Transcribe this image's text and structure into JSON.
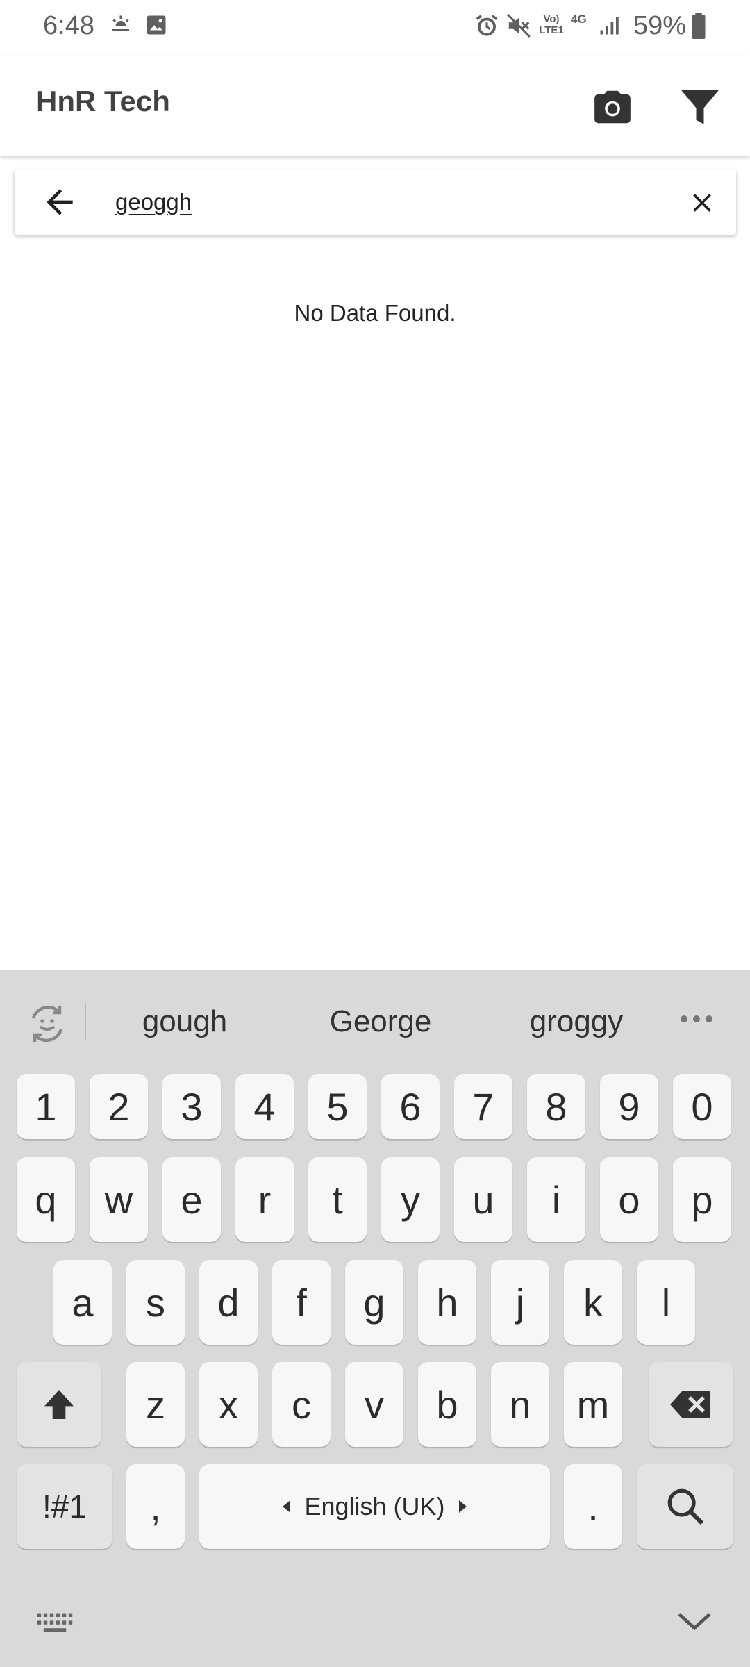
{
  "status_bar": {
    "time": "6:48",
    "battery_percent": "59%",
    "network": "4G",
    "volte": "Vo) LTE1"
  },
  "app_bar": {
    "title": "HnR Tech"
  },
  "search": {
    "query": "geoggh"
  },
  "results": {
    "empty_message": "No Data Found."
  },
  "keyboard": {
    "suggestions": [
      "gough",
      "George",
      "groggy"
    ],
    "number_row": [
      "1",
      "2",
      "3",
      "4",
      "5",
      "6",
      "7",
      "8",
      "9",
      "0"
    ],
    "row1": [
      "q",
      "w",
      "e",
      "r",
      "t",
      "y",
      "u",
      "i",
      "o",
      "p"
    ],
    "row2": [
      "a",
      "s",
      "d",
      "f",
      "g",
      "h",
      "j",
      "k",
      "l"
    ],
    "row3": [
      "z",
      "x",
      "c",
      "v",
      "b",
      "n",
      "m"
    ],
    "symbols_key": "!#1",
    "comma_key": ",",
    "space_label": "English (UK)",
    "period_key": "."
  },
  "colors": {
    "keyboard_bg": "#d9d9d9",
    "key_bg": "#f7f7f7",
    "func_key_bg": "#e3e3e3",
    "icon_color": "#333333"
  }
}
